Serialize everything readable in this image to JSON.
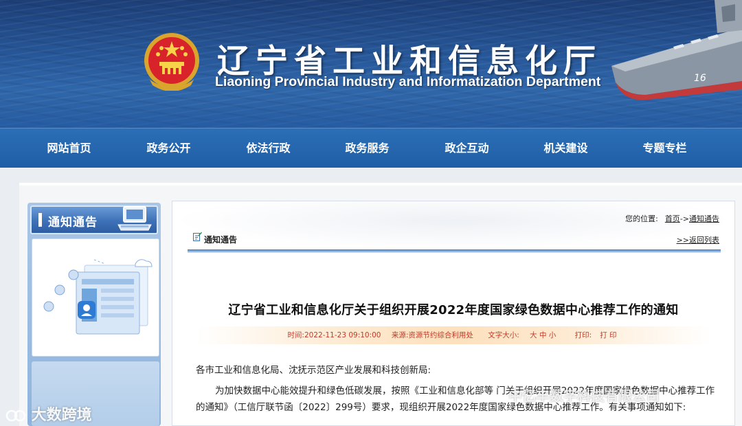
{
  "header": {
    "title": "辽宁省工业和信息化厅",
    "subtitle": "Liaoning Provincial Industry and Informatization Department"
  },
  "nav": {
    "items": [
      {
        "label": "网站首页"
      },
      {
        "label": "政务公开"
      },
      {
        "label": "依法行政"
      },
      {
        "label": "政务服务"
      },
      {
        "label": "政企互动"
      },
      {
        "label": "机关建设"
      },
      {
        "label": "专题专栏"
      }
    ]
  },
  "sidebar": {
    "header": "通知通告"
  },
  "breadcrumb": {
    "prefix": "您的位置:",
    "home": "首页",
    "separator": "->",
    "current": "通知通告"
  },
  "section": {
    "label": "通知通告",
    "back": ">>返回列表"
  },
  "article": {
    "title": "辽宁省工业和信息化厅关于组织开展2022年度国家绿色数据中心推荐工作的通知",
    "time": "时间:2022-11-23 09:10:00",
    "source": "来源:资源节约综合利用处",
    "font_size_label": "文字大小:",
    "font_size_options": "大 中 小",
    "print_label": "打印:",
    "print_action": "打 印",
    "salutation": "各市工业和信息化局、沈抚示范区产业发展和科技创新局:",
    "paragraph": "为加快数据中心能效提升和绿色低碳发展，按照《工业和信息化部等 门关于组织开展2022年度国家绿色数据中心推荐工作的通知》（工信厅联节函〔2022〕299号）要求，现组织开展2022年度国家绿色数据中心推荐工作。有关事项通知如下:"
  },
  "watermarks": {
    "left": "大数跨境",
    "right": "中亿丰数字科技有限公司"
  },
  "colors": {
    "nav_bg": "#2668b0",
    "accent_red": "#c0392b",
    "banner_blue": "#27589a"
  }
}
